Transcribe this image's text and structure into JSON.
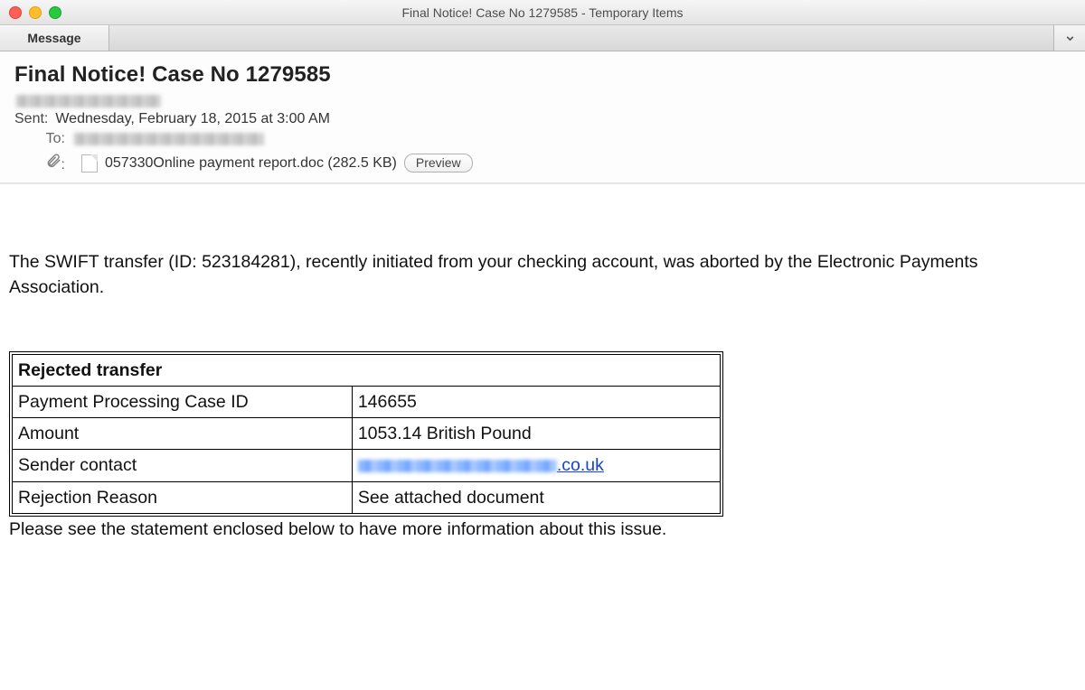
{
  "window": {
    "title": "Final Notice! Case No  1279585 - Temporary Items"
  },
  "tabs": {
    "active": "Message",
    "dropdown_glyph": ""
  },
  "header": {
    "subject": "Final Notice! Case No  1279585",
    "sent_label": "Sent:",
    "sent_value": "Wednesday, February 18, 2015 at 3:00 AM",
    "to_label": "To:",
    "attachment_label_glyph": "📎",
    "attachment_name": "057330Online payment report.doc (282.5 KB)",
    "preview_button": "Preview"
  },
  "body": {
    "intro": "The SWIFT transfer (ID: 523184281), recently initiated from your checking account, was aborted by the Electronic Payments Association.",
    "table_title": "Rejected transfer",
    "rows": {
      "case_id_label": "Payment Processing Case ID",
      "case_id_value": "146655",
      "amount_label": "Amount",
      "amount_value": "1053.14 British Pound",
      "sender_label": "Sender contact",
      "sender_domain": ".co.uk",
      "reason_label": "Rejection Reason",
      "reason_value": "See attached document"
    },
    "closing": "Please see the statement enclosed below to have more information about this issue."
  }
}
